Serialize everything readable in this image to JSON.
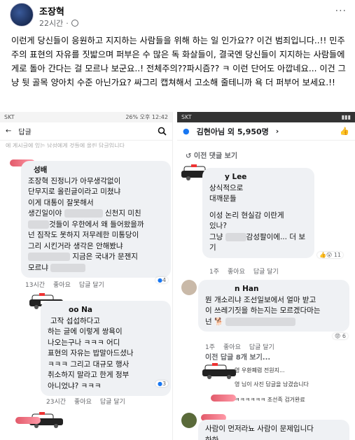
{
  "post": {
    "author": "조장혁",
    "time": "22시간",
    "more": "···",
    "text": "이런게 당신들이 응원하고 지지하는 사람들을 위해 하는 일 인가요?? 이건 범죄입니다..!! 민주주의 표현의 자유를 짓밟으며 퍼부은 수 많은 독 화살들이, 결국엔 당신들이 지지하는 사람들에게로 돌아 간다는 걸 모르나 보군요..! 전체주의??파시즘?? ㅋ 이런 단어도 아깝네요... 이건 그냥 뒷 골목 양아치 수준 아닌가요? 싸그리 캡쳐해서 고소해 줄테니까 욕 더 퍼부어 보세요.!!"
  },
  "left": {
    "status_left": "SKT",
    "status_right": "26% 오후 12:42",
    "back_label": "답글",
    "cut_text": "에 게시글에 있는 남성에게 것들에 올린 답글입니다",
    "c1_name": "성배",
    "c1_lines": [
      "조장혁 진정니가 아무생각없이",
      "단무지로 올린글이라고 미쳤냐",
      "이게 대통이 잘못해서",
      "생긴일이야",
      "신천지 미친",
      "것들이 우한에서 왜 들어왔을까",
      "넌 짐작도 못하지 저무레한  미통당이",
      "그리 시킨거라 생각은 안해봤냐",
      "지금은 국내가 문젠지",
      "모르냐"
    ],
    "c1_time": "13시간",
    "c1_like": "좋아요",
    "c1_reply": "답글 달기",
    "c1_count": "4",
    "c2_name": "oo Na",
    "c2_lines": [
      "고작 섭섭하다고",
      "하는 글에 이렇게 쌍욕이",
      "나오는구나 ㅋㅋㅋ 어디",
      "표현의 자유는 밥말아드셨나",
      "ㅋㅋㅋ 그리고 대규모 행사",
      "취소하지 말라고 한게 정부",
      "아니었냐? ㅋㅋㅋ"
    ],
    "c2_time": "23시간",
    "c2_like": "좋아요",
    "c2_reply": "답글 달기",
    "c2_count": "3"
  },
  "right": {
    "status_left": "SKT",
    "title": "김현아님 외 5,950명",
    "prev": "이전 댓글 보기",
    "c1_name": "y Lee",
    "c1_lines": [
      "상식적으로",
      "대깨문들",
      "",
      "이성 논리 현실감 이란게",
      "있나?",
      "그냥",
      "감성팔이에... 더 보기"
    ],
    "c1_time": "1주",
    "c1_like": "좋아요",
    "c1_reply": "답글 달기",
    "c1_count": "11",
    "c2_name": "n Han",
    "c2_lines": [
      "뭔 개소리냐 조선일보에서 얼마 받고",
      "이 쓰레기짓을 하는지는 모르겠다마는",
      "넌"
    ],
    "c2_time": "1주",
    "c2_like": "좋아요",
    "c2_reply": "답글 달기",
    "c2_count": "6",
    "prev_replies": "이전 답글 8개 보기...",
    "r1": "영 우환폐렴 전원지...",
    "r2": "영 님이 사진 답글을 남겼습니다",
    "r3": "ㅋㅋㅋㅋㅋㅋ 조선족 검거완료",
    "c3_lines": [
      "사람이 먼저라뇨 사람이 문제입니다",
      "하하"
    ]
  },
  "colors": {
    "text": "#050505",
    "meta": "#65676b",
    "bubble": "#eff1f4"
  }
}
